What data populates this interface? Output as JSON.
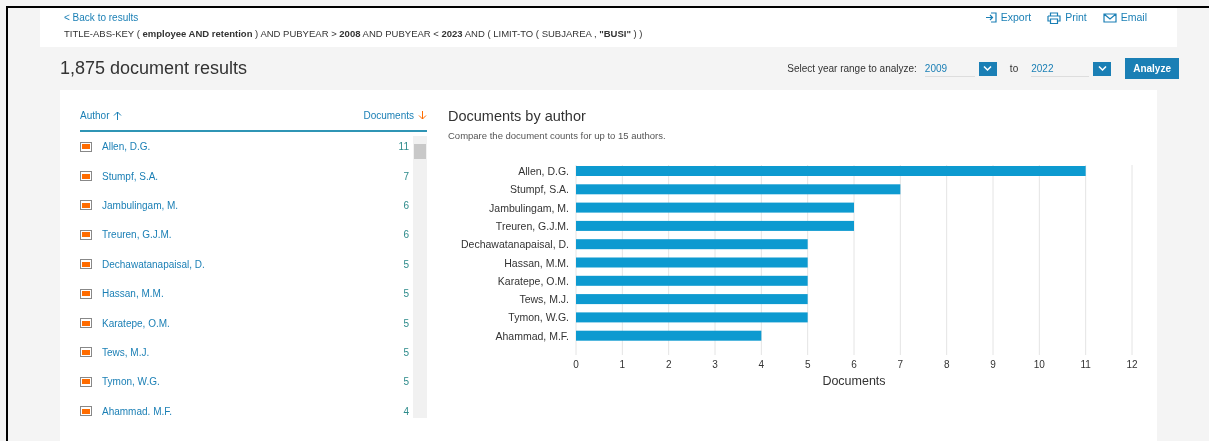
{
  "header": {
    "back_link": "< Back to results",
    "query": "TITLE-ABS-KEY ( **employee AND retention** ) AND PUBYEAR > **2008** AND PUBYEAR < **2023** AND ( LIMIT-TO ( SUBJAREA , **\"BUSI\"** ) )",
    "actions": [
      {
        "kind": "export",
        "label": "Export"
      },
      {
        "kind": "print",
        "label": "Print"
      },
      {
        "kind": "email",
        "label": "Email"
      }
    ]
  },
  "results_title": "1,875 document results",
  "year_range": {
    "label": "Select year range to analyze:",
    "from": "2009",
    "separator": "to",
    "to": "2022",
    "button": "Analyze"
  },
  "author_list": {
    "columns": [
      {
        "label": "Author",
        "kind": "sort_up"
      },
      {
        "label": "Documents",
        "kind": "sort_down"
      }
    ],
    "rows": [
      {
        "name": "Allen, D.G.",
        "count": "11",
        "checked": true
      },
      {
        "name": "Stumpf, S.A.",
        "count": "7",
        "checked": true
      },
      {
        "name": "Jambulingam, M.",
        "count": "6",
        "checked": true
      },
      {
        "name": "Treuren, G.J.M.",
        "count": "6",
        "checked": true
      },
      {
        "name": "Dechawatanapaisal, D.",
        "count": "5",
        "checked": true
      },
      {
        "name": "Hassan, M.M.",
        "count": "5",
        "checked": true
      },
      {
        "name": "Karatepe, O.M.",
        "count": "5",
        "checked": true
      },
      {
        "name": "Tews, M.J.",
        "count": "5",
        "checked": true
      },
      {
        "name": "Tymon, W.G.",
        "count": "5",
        "checked": true
      },
      {
        "name": "Ahammad. M.F.",
        "count": "4",
        "checked": true
      }
    ]
  },
  "chart": {
    "subtitle": "Compare the document counts for up to 15 authors.",
    "chart_data": {
      "type": "bar",
      "orientation": "horizontal",
      "title": "Documents by author",
      "xlabel": "Documents",
      "categories": [
        "Allen, D.G.",
        "Stumpf, S.A.",
        "Jambulingam, M.",
        "Treuren, G.J.M.",
        "Dechawatanapaisal, D.",
        "Hassan, M.M.",
        "Karatepe, O.M.",
        "Tews, M.J.",
        "Tymon, W.G.",
        "Ahammad, M.F."
      ],
      "values": [
        11,
        7,
        6,
        6,
        5,
        5,
        5,
        5,
        5,
        4
      ],
      "grid": true,
      "xlim": [
        0,
        12
      ],
      "xticks": [
        0,
        1,
        2,
        3,
        4,
        5,
        6,
        7,
        8,
        9,
        10,
        11,
        12
      ]
    }
  }
}
